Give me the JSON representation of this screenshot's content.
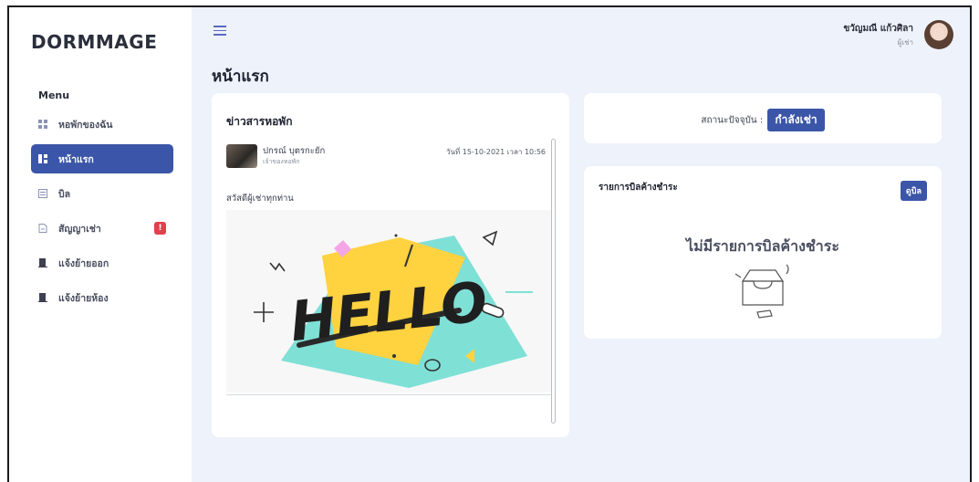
{
  "app": {
    "logo": "DORMMAGE"
  },
  "sidebar": {
    "menu_heading": "Menu",
    "items": [
      {
        "label": "หอพักของฉัน",
        "icon": "grid-icon",
        "active": false
      },
      {
        "label": "หน้าแรก",
        "icon": "dashboard-icon",
        "active": true
      },
      {
        "label": "บิล",
        "icon": "receipt-icon",
        "active": false
      },
      {
        "label": "สัญญาเช่า",
        "icon": "document-icon",
        "active": false,
        "badge": "!"
      },
      {
        "label": "แจ้งย้ายออก",
        "icon": "door-icon",
        "active": false
      },
      {
        "label": "แจ้งย้ายห้อง",
        "icon": "door-icon",
        "active": false
      }
    ]
  },
  "header": {
    "user_name": "ขวัญมณี แก้วศิลา",
    "user_role": "ผู้เช่า"
  },
  "page": {
    "title": "หน้าแรก"
  },
  "news": {
    "title": "ข่าวสารหอพัก",
    "post": {
      "author": "ปกรณ์ บุตรกะยัก",
      "author_role": "เจ้าของหอพัก",
      "date": "วันที่ 15-10-2021 เวลา 10:56",
      "body": "สวัสดีผู้เช่าทุกท่าน",
      "image_text": "HELLO"
    }
  },
  "status": {
    "label": "สถานะปัจจุบัน :",
    "value": "กำลังเช่า"
  },
  "bills": {
    "title": "รายการบิลค้างชำระ",
    "view_button": "ดูบิล",
    "empty_text": "ไม่มีรายการบิลค้างชำระ"
  },
  "colors": {
    "primary": "#3b56a8",
    "background": "#eef2fa",
    "badge": "#e0414c"
  }
}
